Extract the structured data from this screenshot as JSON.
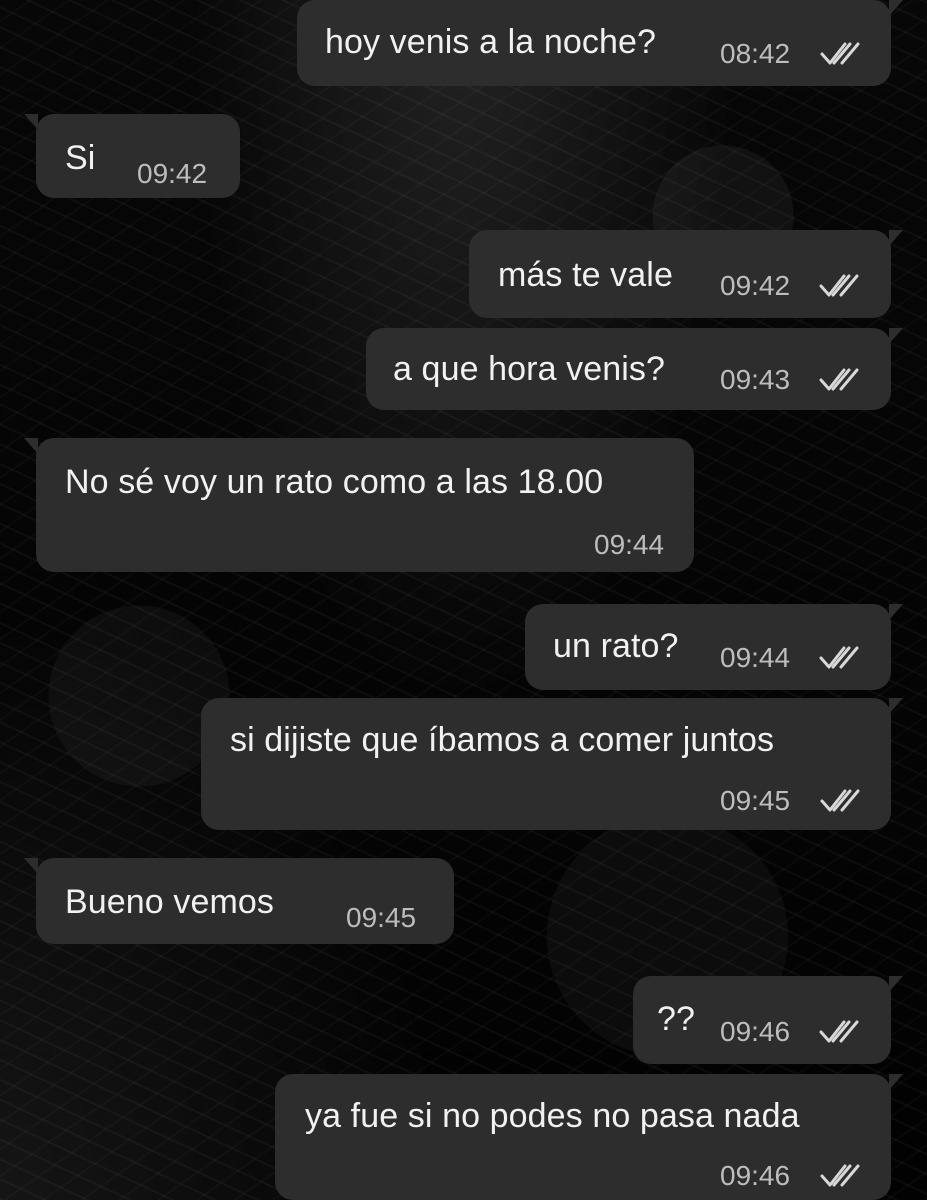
{
  "chat": {
    "messages": [
      {
        "direction": "outgoing",
        "text": "hoy venis a la noche?",
        "time": "08:42",
        "status_icon": "double-check-icon"
      },
      {
        "direction": "incoming",
        "text": "Si",
        "time": "09:42"
      },
      {
        "direction": "outgoing",
        "text": "más te vale",
        "time": "09:42",
        "status_icon": "double-check-icon"
      },
      {
        "direction": "outgoing",
        "text": "a que hora venis?",
        "time": "09:43",
        "status_icon": "double-check-icon"
      },
      {
        "direction": "incoming",
        "text": "No sé voy un rato como a las 18.00",
        "time": "09:44"
      },
      {
        "direction": "outgoing",
        "text": "un rato?",
        "time": "09:44",
        "status_icon": "double-check-icon"
      },
      {
        "direction": "outgoing",
        "text": "si dijiste que íbamos a comer juntos",
        "time": "09:45",
        "status_icon": "double-check-icon"
      },
      {
        "direction": "incoming",
        "text": "Bueno vemos",
        "time": "09:45"
      },
      {
        "direction": "outgoing",
        "text": "??",
        "time": "09:46",
        "status_icon": "double-check-icon"
      },
      {
        "direction": "outgoing",
        "text": "ya fue si no podes no pasa nada",
        "time": "09:46",
        "status_icon": "double-check-icon"
      }
    ]
  },
  "theme": {
    "bubble_color": "#2d2d2d",
    "text_color": "#f1f1f1",
    "time_color": "#bdbdbd",
    "check_color": "#d8d8d8",
    "background_color": "#050505"
  }
}
